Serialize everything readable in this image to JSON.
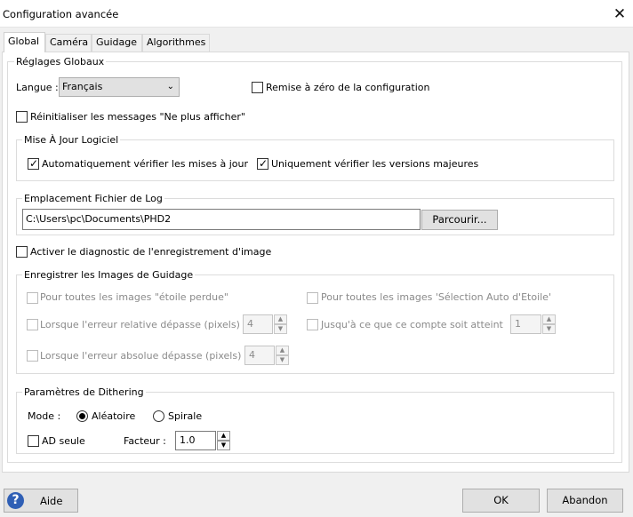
{
  "window": {
    "title": "Configuration avancée",
    "close_glyph": "✕"
  },
  "tabs": [
    {
      "label": "Global",
      "active": true
    },
    {
      "label": "Caméra"
    },
    {
      "label": "Guidage"
    },
    {
      "label": "Algorithmes"
    }
  ],
  "global": {
    "group_title": "Réglages Globaux",
    "language_label": "Langue :",
    "language_value": "Français",
    "reset_config_label": "Remise à zéro de la configuration",
    "reset_config_checked": false,
    "reset_messages_label": "Réinitialiser les messages \"Ne plus afficher\"",
    "reset_messages_checked": false
  },
  "software_update": {
    "group_title": "Mise À Jour Logiciel",
    "auto_check_label": "Automatiquement vérifier les mises à jour",
    "auto_check_checked": true,
    "major_only_label": "Uniquement vérifier les versions majeures",
    "major_only_checked": true
  },
  "log_location": {
    "group_title": "Emplacement Fichier de Log",
    "path_value": "C:\\Users\\pc\\Documents\\PHD2",
    "browse_label": "Parcourir..."
  },
  "image_diagnostic": {
    "label": "Activer le diagnostic de l'enregistrement d'image",
    "checked": false
  },
  "guide_images": {
    "group_title": "Enregistrer les Images de Guidage",
    "all_lost_star_label": "Pour toutes les images \"étoile perdue\"",
    "all_auto_select_label": "Pour toutes les images 'Sélection Auto d'Etoile'",
    "relative_error_label": "Lorsque l'erreur relative dépasse (pixels)",
    "relative_error_value": "4",
    "until_count_label": "Jusqu'à ce que ce compte soit atteint",
    "until_count_value": "1",
    "absolute_error_label": "Lorsque l'erreur absolue dépasse (pixels)",
    "absolute_error_value": "4"
  },
  "dithering": {
    "group_title": "Paramètres de Dithering",
    "mode_label": "Mode :",
    "random_label": "Aléatoire",
    "random_selected": true,
    "spiral_label": "Spirale",
    "spiral_selected": false,
    "ra_only_label": "AD seule",
    "ra_only_checked": false,
    "factor_label": "Facteur :",
    "factor_value": "1.0"
  },
  "footer": {
    "help_label": "Aide",
    "help_icon_glyph": "?",
    "ok_label": "OK",
    "cancel_label": "Abandon"
  },
  "icons": {
    "check": "✓",
    "dropdown": "chevron-down",
    "spin_up": "▲",
    "spin_down": "▼"
  },
  "colors": {
    "window_bg": "#f0f0f0",
    "panel_bg": "#ffffff",
    "help_icon": "#2f5fb5",
    "disabled_text": "#8a8a8a"
  }
}
